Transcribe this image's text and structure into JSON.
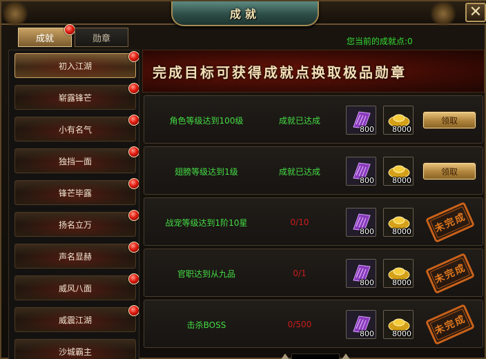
{
  "window": {
    "title": "成就"
  },
  "tabs": [
    {
      "label": "成就",
      "active": true,
      "badge": true
    },
    {
      "label": "勋章",
      "active": false,
      "badge": false
    }
  ],
  "points": {
    "label": "您当前的成就点:0"
  },
  "categories": [
    {
      "label": "初入江湖",
      "active": true,
      "badge": true
    },
    {
      "label": "崭露锋芒",
      "active": false,
      "badge": true
    },
    {
      "label": "小有名气",
      "active": false,
      "badge": true
    },
    {
      "label": "独挡一面",
      "active": false,
      "badge": true
    },
    {
      "label": "锋芒毕露",
      "active": false,
      "badge": true
    },
    {
      "label": "扬名立万",
      "active": false,
      "badge": true
    },
    {
      "label": "声名显赫",
      "active": false,
      "badge": true
    },
    {
      "label": "威风八面",
      "active": false,
      "badge": true
    },
    {
      "label": "威震江湖",
      "active": false,
      "badge": true
    },
    {
      "label": "沙城霸主",
      "active": false,
      "badge": false
    }
  ],
  "banner": {
    "text": "完成目标可获得成就点换取极品勋章"
  },
  "achievements": [
    {
      "name": "角色等级达到100级",
      "status": "成就已达成",
      "completed": true,
      "reward1": {
        "icon": "purple-scroll-icon",
        "count": "800"
      },
      "reward2": {
        "icon": "gold-ingot-icon",
        "count": "8000"
      },
      "action_label": "领取"
    },
    {
      "name": "翅膀等级达到1级",
      "status": "成就已达成",
      "completed": true,
      "reward1": {
        "icon": "purple-scroll-icon",
        "count": "800"
      },
      "reward2": {
        "icon": "gold-ingot-icon",
        "count": "8000"
      },
      "action_label": "领取"
    },
    {
      "name": "战宠等级达到1阶10星",
      "status": "0/10",
      "completed": false,
      "reward1": {
        "icon": "purple-scroll-icon",
        "count": "800"
      },
      "reward2": {
        "icon": "gold-ingot-icon",
        "count": "8000"
      },
      "stamp_label": "未完成"
    },
    {
      "name": "官职达到从九品",
      "status": "0/1",
      "completed": false,
      "reward1": {
        "icon": "purple-scroll-icon",
        "count": "800"
      },
      "reward2": {
        "icon": "gold-ingot-icon",
        "count": "8000"
      },
      "stamp_label": "未完成"
    },
    {
      "name": "击杀BOSS",
      "status": "0/500",
      "completed": false,
      "reward1": {
        "icon": "purple-scroll-icon",
        "count": "800"
      },
      "reward2": {
        "icon": "gold-ingot-icon",
        "count": "8000"
      },
      "stamp_label": "未完成"
    }
  ],
  "colors": {
    "completed_text": "#44dd44",
    "progress_text": "#cc1c1c",
    "stamp": "#e0781e",
    "accent_gold": "#c9a466"
  }
}
